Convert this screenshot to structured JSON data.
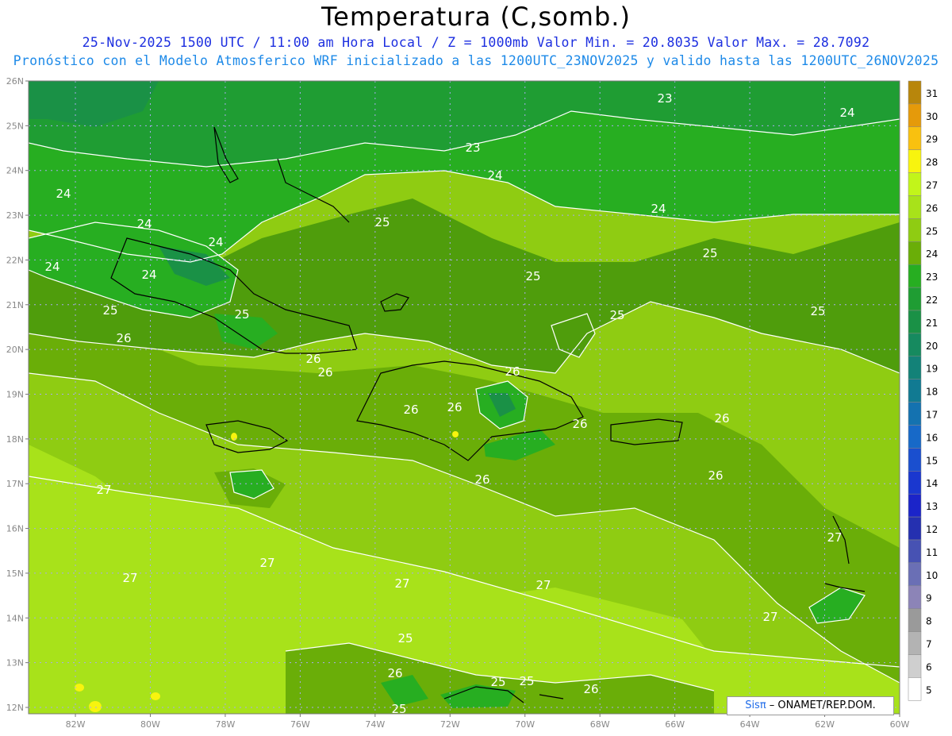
{
  "title": "Temperatura (C,somb.)",
  "subtitle_line1": "25-Nov-2025 1500 UTC / 11:00 am Hora Local / Z = 1000mb  Valor Min. = 20.8035  Valor Max. = 28.7092",
  "subtitle_line2": "Pronóstico con el Modelo Atmosferico WRF inicializado a las 1200UTC_23NOV2025 y valido hasta las  1200UTC_26NOV2025",
  "credit_brand": "Sisπ",
  "credit_text": " – ONAMET/REP.DOM.",
  "lat_labels": [
    "26N",
    "25N",
    "24N",
    "23N",
    "22N",
    "21N",
    "20N",
    "19N",
    "18N",
    "17N",
    "16N",
    "15N",
    "14N",
    "13N",
    "12N"
  ],
  "lon_labels": [
    "82W",
    "80W",
    "78W",
    "76W",
    "74W",
    "72W",
    "70W",
    "68W",
    "66W",
    "64W",
    "62W",
    "60W"
  ],
  "colorbar": {
    "values": [
      "31",
      "30",
      "29",
      "28",
      "27",
      "26",
      "25",
      "24",
      "23",
      "22",
      "21",
      "20",
      "19",
      "18",
      "17",
      "16",
      "15",
      "14",
      "13",
      "12",
      "11",
      "10",
      "9",
      "8",
      "7",
      "6",
      "5"
    ],
    "colors": [
      "#b8860b",
      "#e59a0a",
      "#f9c10f",
      "#f8f40e",
      "#c2f51a",
      "#a8e21a",
      "#8fcc12",
      "#6aae08",
      "#27ae21",
      "#1f9d33",
      "#1a9146",
      "#168a5f",
      "#138278",
      "#117a92",
      "#1472b0",
      "#1769c8",
      "#1a4fcf",
      "#1a37cf",
      "#1b24c9",
      "#2530b0",
      "#4752b3",
      "#6a6fb5",
      "#8c84b7",
      "#9a9a9a",
      "#b3b3b3",
      "#cfcfcf",
      "#ffffff"
    ]
  },
  "contour_labels": [
    "23",
    "24",
    "23",
    "24",
    "24",
    "24",
    "24",
    "24",
    "24",
    "24",
    "25",
    "25",
    "25",
    "25",
    "25",
    "25",
    "25",
    "26",
    "26",
    "26",
    "26",
    "26",
    "26",
    "26",
    "26",
    "26",
    "26",
    "27",
    "27",
    "27",
    "27",
    "27",
    "27",
    "27",
    "25",
    "26",
    "25",
    "26",
    "25",
    "25"
  ]
}
